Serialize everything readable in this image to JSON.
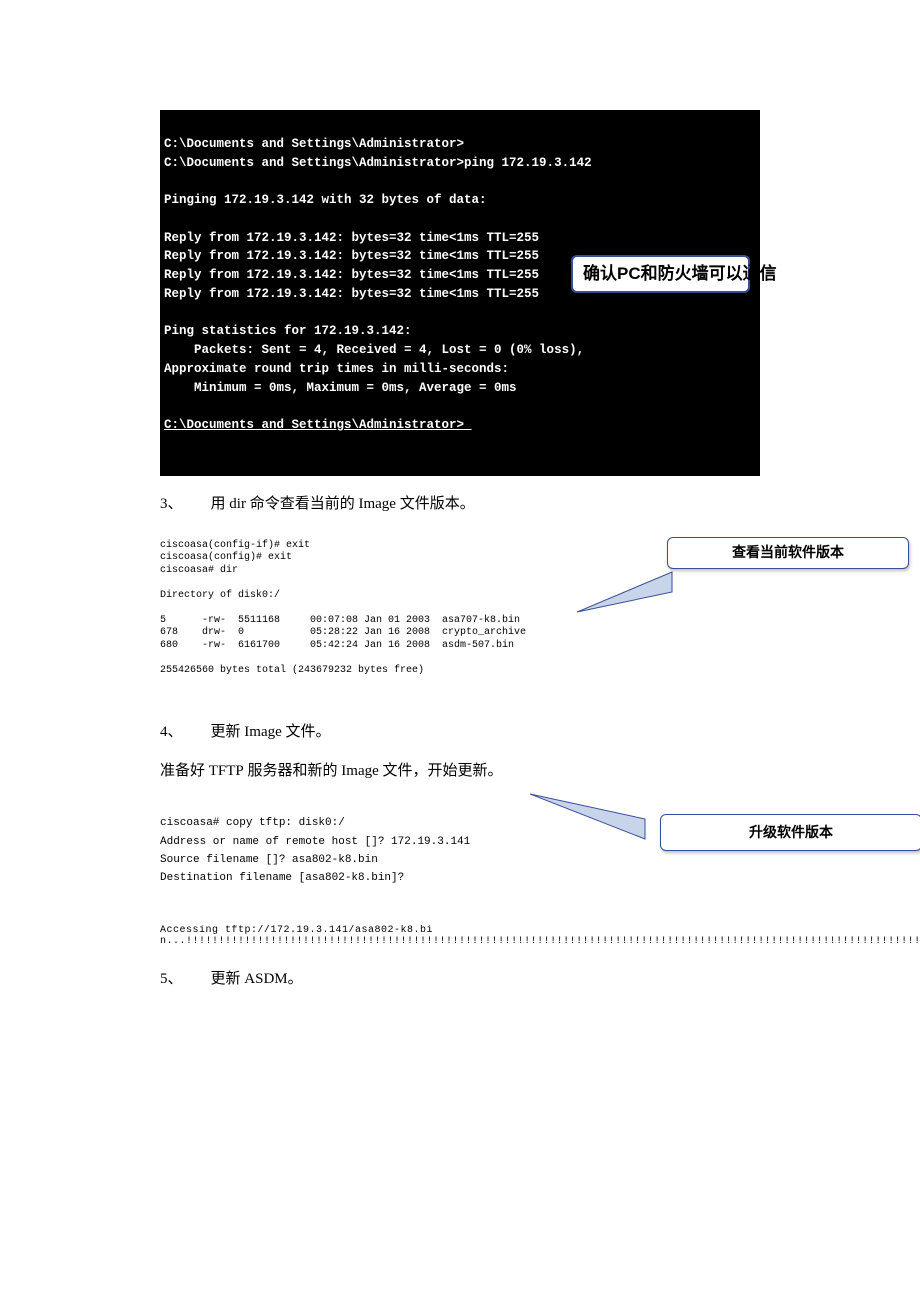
{
  "terminal1": {
    "line1": "C:\\Documents and Settings\\Administrator>",
    "line2": "C:\\Documents and Settings\\Administrator>ping 172.19.3.142",
    "blank1": "",
    "line3": "Pinging 172.19.3.142 with 32 bytes of data:",
    "blank2": "",
    "line4": "Reply from 172.19.3.142: bytes=32 time<1ms TTL=255",
    "line5": "Reply from 172.19.3.142: bytes=32 time<1ms TTL=255",
    "line6": "Reply from 172.19.3.142: bytes=32 time<1ms TTL=255",
    "line7": "Reply from 172.19.3.142: bytes=32 time<1ms TTL=255",
    "blank3": "",
    "line8": "Ping statistics for 172.19.3.142:",
    "line9": "    Packets: Sent = 4, Received = 4, Lost = 0 (0% loss),",
    "line10": "Approximate round trip times in milli-seconds:",
    "line11": "    Minimum = 0ms, Maximum = 0ms, Average = 0ms",
    "blank4": "",
    "line12": "C:\\Documents and Settings\\Administrator>_"
  },
  "callout1": "确认PC和防火墙可以通信",
  "step3": {
    "num": "3、",
    "text_cn1": "用 ",
    "cmd": "dir",
    "text_cn2": " 命令查看当前的 ",
    "img": "Image",
    "text_cn3": " 文件版本。"
  },
  "terminal2": {
    "l1": "ciscoasa(config-if)# exit",
    "l2": "ciscoasa(config)# exit",
    "l3": "ciscoasa# dir",
    "blank1": " ",
    "l4": "Directory of disk0:/",
    "blank2": " ",
    "l5": "5      -rw-  5511168     00:07:08 Jan 01 2003  asa707-k8.bin",
    "l6": "678    drw-  0           05:28:22 Jan 16 2008  crypto_archive",
    "l7": "680    -rw-  6161700     05:42:24 Jan 16 2008  asdm-507.bin",
    "blank3": " ",
    "l8": "255426560 bytes total (243679232 bytes free)"
  },
  "callout2": "查看当前软件版本",
  "step4": {
    "num": "4、",
    "text_cn1": "更新 ",
    "img": "Image",
    "text_cn2": " 文件。"
  },
  "para4": {
    "t1": "准备好 ",
    "en1": "TFTP",
    "t2": " 服务器和新的 ",
    "en2": "Image",
    "t3": " 文件，开始更新。"
  },
  "terminal3": {
    "l1": "ciscoasa# copy tftp: disk0:/",
    "l2": "Address or name of remote host []? 172.19.3.141",
    "l3": "Source filename []? asa802-k8.bin",
    "l4": "Destination filename [asa802-k8.bin]?"
  },
  "callout3": "升级软件版本",
  "progress_prefix": "Accessing tftp://172.19.3.141/asa802-k8.bin...",
  "step5": {
    "num": "5、",
    "text_cn1": "更新 ",
    "asdm": "ASDM",
    "text_cn2": "。"
  }
}
